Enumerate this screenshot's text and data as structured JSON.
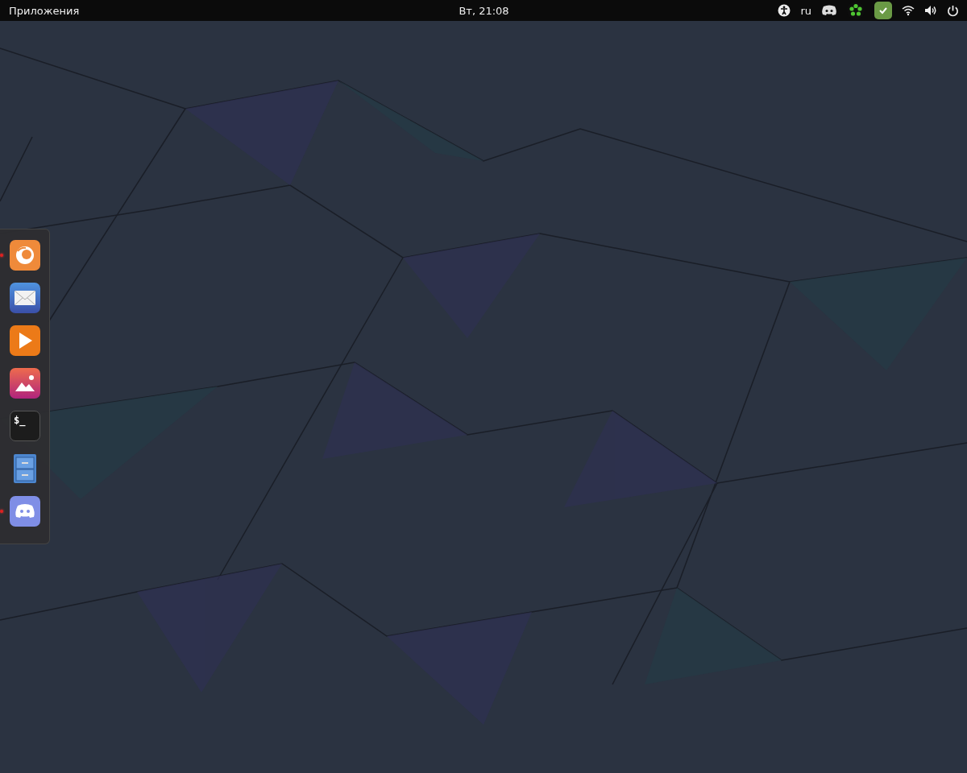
{
  "top_bar": {
    "applications_menu": "Приложения",
    "clock": "Вт, 21:08",
    "language": "ru",
    "tray": [
      {
        "kind": "accessibility"
      },
      {
        "kind": "language"
      },
      {
        "kind": "discord"
      },
      {
        "kind": "icq"
      },
      {
        "kind": "check"
      },
      {
        "kind": "wifi"
      },
      {
        "kind": "volume"
      },
      {
        "kind": "power"
      }
    ]
  },
  "dock": {
    "items": [
      {
        "kind": "browser",
        "running": true
      },
      {
        "kind": "mail",
        "running": false
      },
      {
        "kind": "video",
        "running": false
      },
      {
        "kind": "photos",
        "running": false
      },
      {
        "kind": "terminal",
        "running": false,
        "glyph": "$_"
      },
      {
        "kind": "files",
        "running": false
      },
      {
        "kind": "chat",
        "running": true
      }
    ]
  }
}
